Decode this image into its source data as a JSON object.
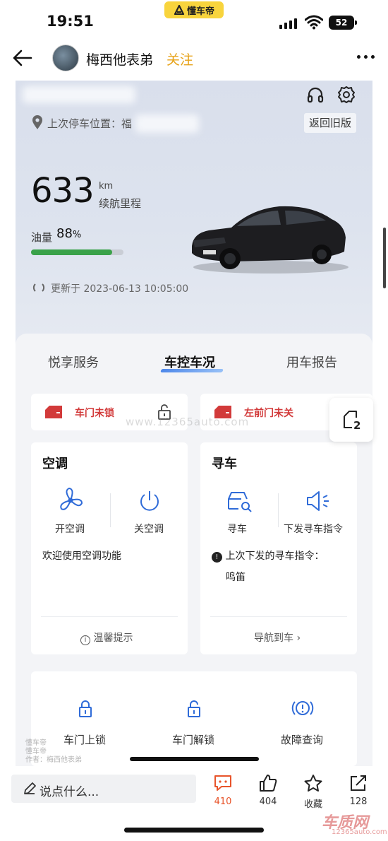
{
  "status_bar": {
    "time": "19:51",
    "app_badge": "懂车帝",
    "battery": "52"
  },
  "header": {
    "author": "梅西他表弟",
    "follow": "关注"
  },
  "car_app": {
    "last_park_label": "上次停车位置：",
    "last_park_partial": "福",
    "old_version_button": "返回旧版",
    "range_value": "633",
    "range_unit": "km",
    "range_label": "续航里程",
    "fuel_label": "油量",
    "fuel_value": "88",
    "fuel_percent_sign": "%",
    "fuel_fraction": 0.88,
    "updated_text": "更新于 2023-06-13 10:05:00",
    "tabs": [
      {
        "label": "悦享服务"
      },
      {
        "label": "车控车况"
      },
      {
        "label": "用车报告"
      }
    ],
    "alerts": [
      {
        "label": "车门未锁"
      },
      {
        "label": "左前门未关"
      }
    ],
    "watermark": "www.12365auto.com",
    "ac_panel": {
      "title": "空调",
      "on_label": "开空调",
      "off_label": "关空调",
      "message": "欢迎使用空调功能",
      "footer": "温馨提示"
    },
    "find_panel": {
      "title": "寻车",
      "find_label": "寻车",
      "send_label": "下发寻车指令",
      "last_cmd_label": "上次下发的寻车指令：",
      "last_cmd_value": "鸣笛",
      "footer": "导航到车"
    },
    "quick_actions": [
      {
        "label": "车门上锁"
      },
      {
        "label": "车门解锁"
      },
      {
        "label": "故障查询"
      }
    ],
    "float_badge": "2",
    "bottom_watermark": "懂车帝\n懂车帝\n作者：梅西他表弟"
  },
  "bottom_bar": {
    "comment_placeholder": "说点什么...",
    "actions": [
      {
        "label": "410",
        "icon": "comment-icon",
        "color": "#e8542a"
      },
      {
        "label": "404",
        "icon": "like-icon"
      },
      {
        "label": "收藏",
        "icon": "star-icon"
      },
      {
        "label": "128",
        "icon": "share-icon"
      }
    ]
  },
  "brand_watermark": "车质网",
  "brand_watermark_url": "12365auto.com"
}
